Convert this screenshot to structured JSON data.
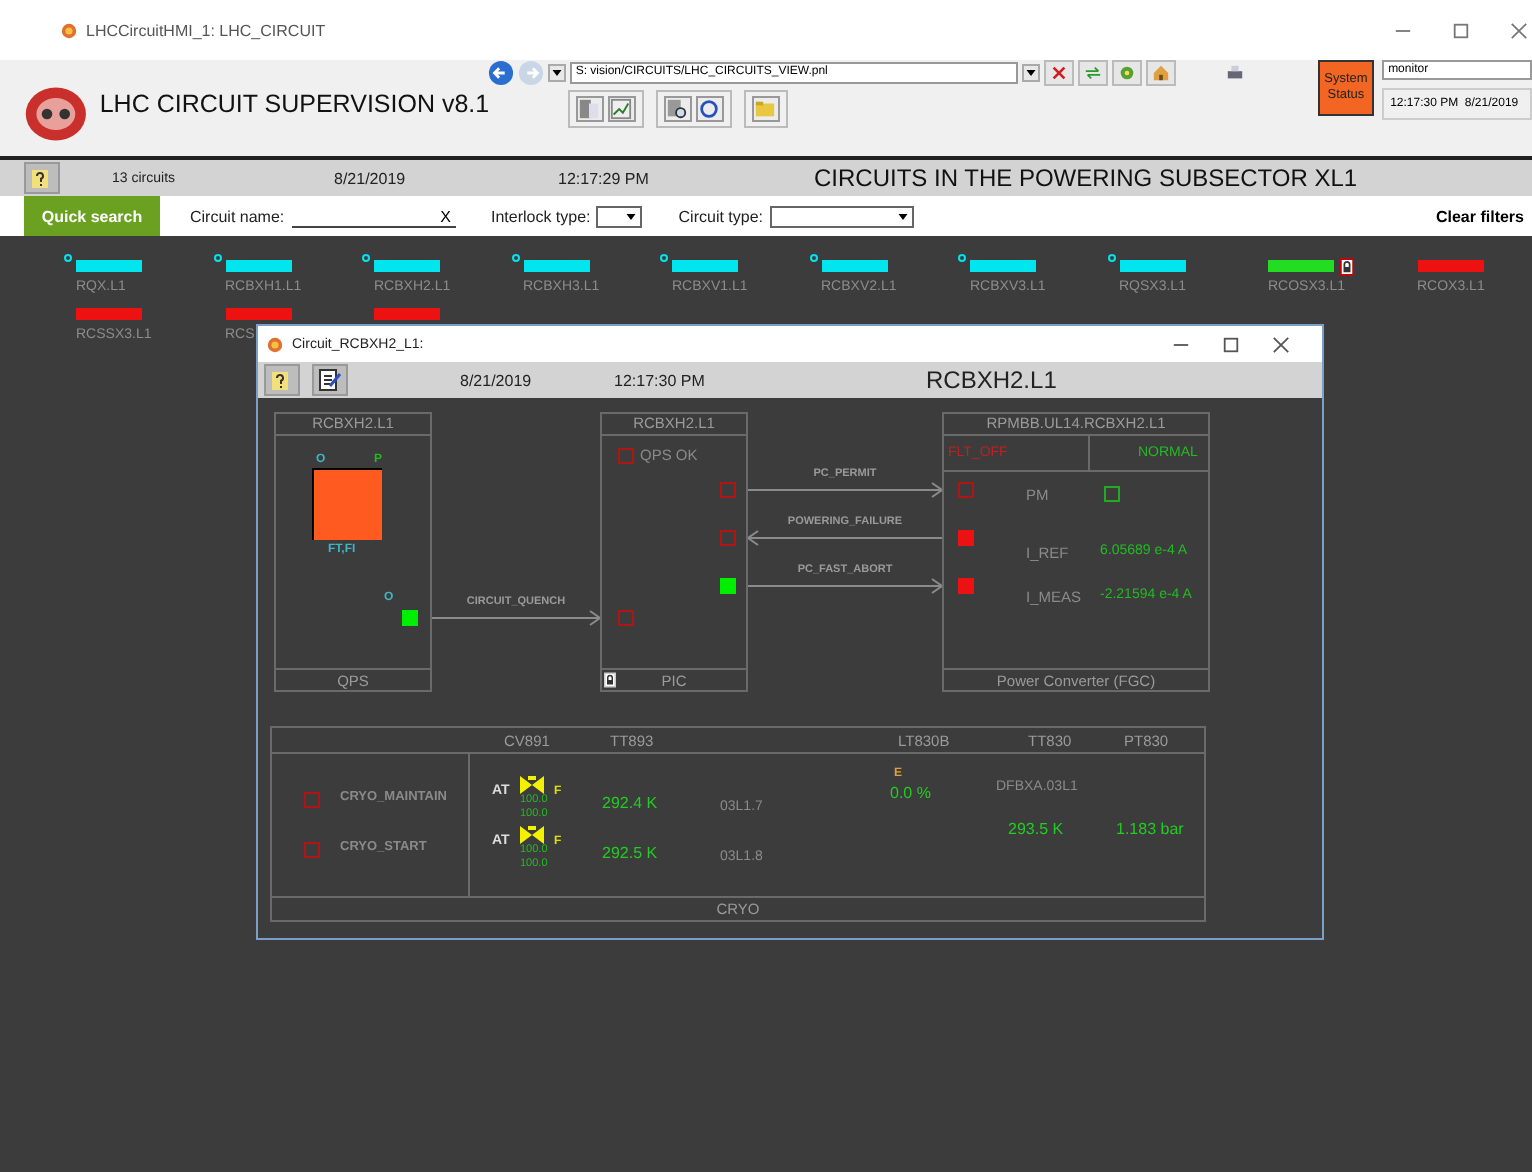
{
  "window": {
    "title": "LHCCircuitHMI_1: LHC_CIRCUIT"
  },
  "header": {
    "title": "LHC CIRCUIT SUPERVISION v8.1",
    "path": "S: vision/CIRCUITS/LHC_CIRCUITS_VIEW.pnl",
    "status_button": "System Status",
    "user": "monitor",
    "time": "12:17:30 PM",
    "date": "8/21/2019"
  },
  "status_strip": {
    "count": "13 circuits",
    "date": "8/21/2019",
    "time": "12:17:29 PM",
    "title": "CIRCUITS IN THE POWERING SUBSECTOR XL1"
  },
  "filters": {
    "quick_search": "Quick search",
    "name_label": "Circuit name:",
    "name_clear": "X",
    "interlock_label": "Interlock type:",
    "type_label": "Circuit type:",
    "clear_filters": "Clear filters"
  },
  "circuits": [
    {
      "name": "RQX.L1",
      "color": "#00e5ee",
      "marker": true,
      "locked": false
    },
    {
      "name": "RCBXH1.L1",
      "color": "#00e5ee",
      "marker": true,
      "locked": false
    },
    {
      "name": "RCBXH2.L1",
      "color": "#00e5ee",
      "marker": true,
      "locked": false
    },
    {
      "name": "RCBXH3.L1",
      "color": "#00e5ee",
      "marker": true,
      "locked": false
    },
    {
      "name": "RCBXV1.L1",
      "color": "#00e5ee",
      "marker": true,
      "locked": false
    },
    {
      "name": "RCBXV2.L1",
      "color": "#00e5ee",
      "marker": true,
      "locked": false
    },
    {
      "name": "RCBXV3.L1",
      "color": "#00e5ee",
      "marker": true,
      "locked": false
    },
    {
      "name": "RQSX3.L1",
      "color": "#00e5ee",
      "marker": true,
      "locked": false
    },
    {
      "name": "RCOSX3.L1",
      "color": "#22dd22",
      "marker": false,
      "locked": true
    },
    {
      "name": "RCOX3.L1",
      "color": "#ee1111",
      "marker": false,
      "locked": false
    },
    {
      "name": "RCSSX3.L1",
      "color": "#ee1111",
      "marker": false,
      "locked": false
    },
    {
      "name": "RCS",
      "color": "#ee1111",
      "marker": false,
      "locked": false
    },
    {
      "color": "#ee1111",
      "marker": false,
      "locked": false
    }
  ],
  "dialog": {
    "title": "Circuit_RCBXH2_L1:",
    "date": "8/21/2019",
    "time": "12:17:30 PM",
    "circuit": "RCBXH2.L1",
    "qps": {
      "header": "RCBXH2.L1",
      "footer": "QPS",
      "left_tag": "O",
      "right_tag": "P",
      "state_label": "FT,FI",
      "out_tag": "O"
    },
    "pic": {
      "header": "RCBXH2.L1",
      "footer": "PIC",
      "locked": true,
      "qps_ok": {
        "label": "QPS OK",
        "on": false,
        "color": "#b01515"
      }
    },
    "links": [
      {
        "kind": "qps",
        "label": "CIRCUIT_QUENCH",
        "reverse": false,
        "left": {
          "on": true,
          "color": "#00ee00"
        },
        "right": {
          "on": false,
          "color": "#b01515"
        }
      },
      {
        "kind": "fgc",
        "label": "PC_PERMIT",
        "reverse": false,
        "left": {
          "on": false,
          "color": "#b01515"
        },
        "right": {
          "on": false,
          "color": "#b01515"
        }
      },
      {
        "kind": "fgc",
        "label": "POWERING_FAILURE",
        "reverse": true,
        "left": {
          "on": false,
          "color": "#b01515"
        },
        "right": {
          "on": true,
          "color": "#ee1111"
        }
      },
      {
        "kind": "fgc",
        "label": "PC_FAST_ABORT",
        "reverse": false,
        "left": {
          "on": true,
          "color": "#00ee00"
        },
        "right": {
          "on": true,
          "color": "#ee1111"
        }
      }
    ],
    "fgc": {
      "header": "RPMBB.UL14.RCBXH2.L1",
      "state": "FLT_OFF",
      "mode": "NORMAL",
      "pm": {
        "label": "PM",
        "on": false,
        "color": "#22aa22"
      },
      "readings": [
        {
          "label": "I_REF",
          "value": "6.05689 e-4 A"
        },
        {
          "label": "I_MEAS",
          "value": "-2.21594 e-4 A"
        }
      ],
      "footer": "Power Converter (FGC)"
    },
    "cryo": {
      "columns": [
        "CV891",
        "TT893",
        "LT830B",
        "TT830",
        "PT830"
      ],
      "rows": [
        {
          "label": "CRYO_MAINTAIN",
          "indicator": {
            "on": false,
            "color": "#b01515"
          },
          "valve_mode": "AT",
          "valve_tag": "F",
          "valve_out": "100.0",
          "valve_in": "100.0",
          "temperature": "292.4 K",
          "sensor": "03L1.7"
        },
        {
          "label": "CRYO_START",
          "indicator": {
            "on": false,
            "color": "#b01515"
          },
          "valve_mode": "AT",
          "valve_tag": "F",
          "valve_out": "100.0",
          "valve_in": "100.0",
          "temperature": "292.5 K",
          "sensor": "03L1.8"
        }
      ],
      "level_tag": "E",
      "level_reading": "0.0 %",
      "dfb": "DFBXA.03L1",
      "dfb_temperature": "293.5 K",
      "dfb_pressure": "1.183 bar",
      "footer": "CRYO"
    }
  }
}
